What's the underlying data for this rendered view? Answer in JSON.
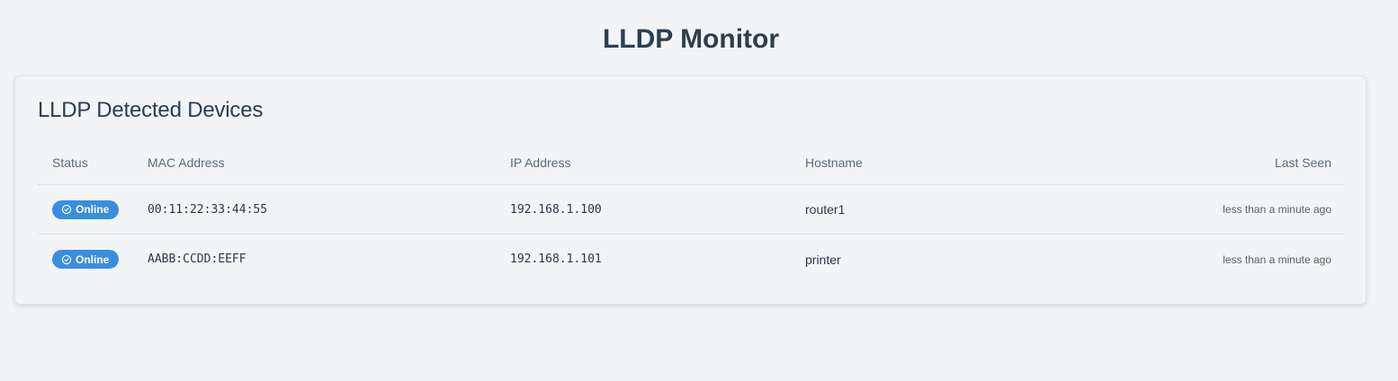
{
  "header": {
    "title": "LLDP Monitor"
  },
  "card": {
    "title": "LLDP Detected Devices"
  },
  "table": {
    "columns": [
      "Status",
      "MAC Address",
      "IP Address",
      "Hostname",
      "Last Seen"
    ],
    "rows": [
      {
        "status": "Online",
        "status_icon": "check-circle-icon",
        "mac": "00:11:22:33:44:55",
        "ip": "192.168.1.100",
        "hostname": "router1",
        "last_seen": "less than a minute ago"
      },
      {
        "status": "Online",
        "status_icon": "check-circle-icon",
        "mac": "AABB:CCDD:EEFF",
        "ip": "192.168.1.101",
        "hostname": "printer",
        "last_seen": "less than a minute ago"
      }
    ]
  },
  "colors": {
    "background": "#f3f4f6",
    "badge_online": "#3a8ee0",
    "title_text": "#2c3e50"
  }
}
